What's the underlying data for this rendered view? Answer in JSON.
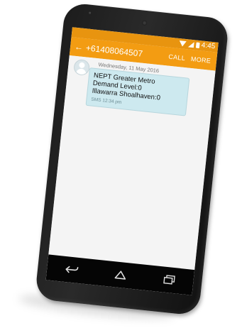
{
  "status_bar": {
    "time": "4:45"
  },
  "app_bar": {
    "back_icon": "arrow-left-icon",
    "title": "+61408064507",
    "call_label": "CALL",
    "more_label": "MORE"
  },
  "conversation": {
    "date": "Wednesday, 11 May 2016",
    "messages": [
      {
        "lines": [
          "NEPT Greater Metro",
          "Demand Level:0",
          "Illawarra Shoalhaven:0"
        ],
        "meta": "SMS 12:34 pm"
      }
    ]
  },
  "nav_bar": {
    "back": "back-icon",
    "home": "home-icon",
    "recents": "recents-icon"
  },
  "colors": {
    "accent": "#f39c12",
    "status_bar": "#e8940f",
    "bubble": "#cde9ef",
    "phone_body": "#1c1c1c"
  }
}
